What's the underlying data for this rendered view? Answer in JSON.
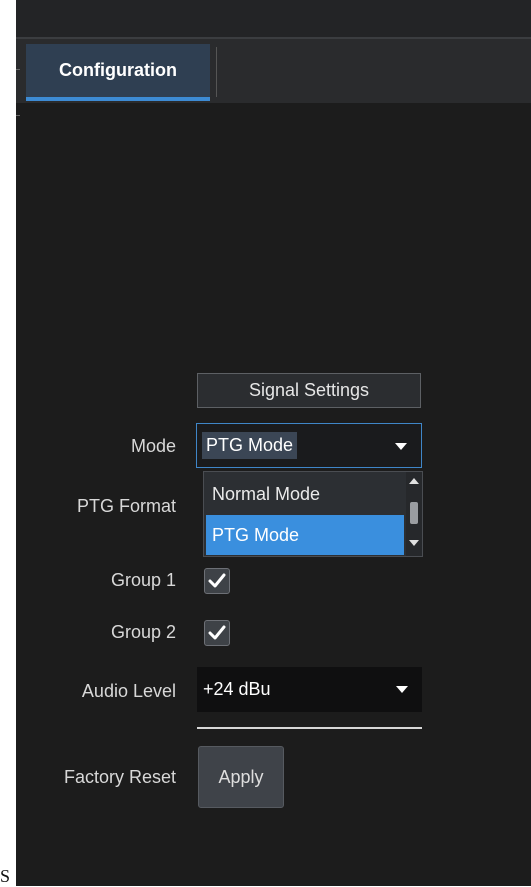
{
  "tabs": [
    {
      "label": "Configuration",
      "active": true
    }
  ],
  "section": {
    "title": "Signal Settings"
  },
  "fields": {
    "mode": {
      "label": "Mode",
      "value": "PTG Mode",
      "options": [
        "Normal Mode",
        "PTG Mode"
      ],
      "selected_index": 1
    },
    "ptg_format": {
      "label": "PTG Format"
    },
    "group1": {
      "label": "Group 1",
      "checked": true
    },
    "group2": {
      "label": "Group 2",
      "checked": true
    },
    "audio_level": {
      "label": "Audio Level",
      "value": "+24 dBu"
    },
    "factory_reset": {
      "label": "Factory Reset",
      "button_label": "Apply"
    }
  },
  "stray_text": "S",
  "colors": {
    "accent": "#3d8bd4",
    "selected_option": "#3a8fde",
    "panel_bg": "#1c1c1c"
  }
}
